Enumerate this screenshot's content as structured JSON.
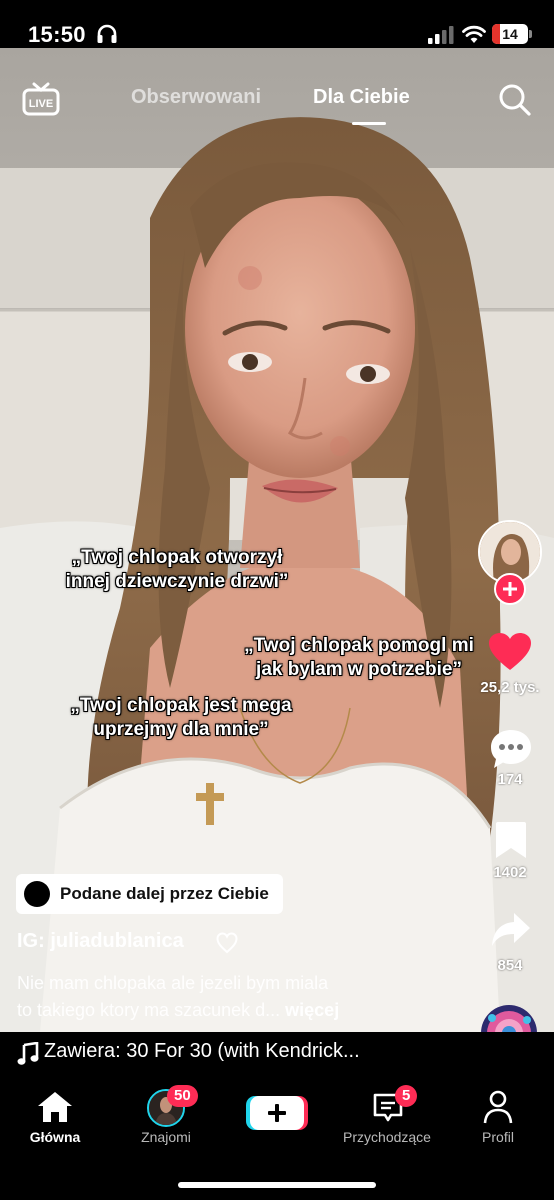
{
  "status_bar": {
    "time": "15:50",
    "battery": "14"
  },
  "top_nav": {
    "live_icon": "live-tv-icon",
    "tabs": [
      {
        "label": "Obserwowani",
        "active": false
      },
      {
        "label": "Dla Ciebie",
        "active": true
      }
    ],
    "search_icon": "search-icon"
  },
  "overlay_captions": [
    {
      "lines": [
        "„Twoj chlopak otworzył",
        "innej dziewczynie drzwi”"
      ]
    },
    {
      "lines": [
        "„Twoj chlopak pomogl mi",
        "jak bylam w potrzebie”"
      ]
    },
    {
      "lines": [
        "„Twoj chlopak jest mega",
        "uprzejmy dla mnie”"
      ]
    }
  ],
  "right_rail": {
    "likes": "25,2 tys.",
    "comments": "174",
    "saves": "1402",
    "shares": "854"
  },
  "post": {
    "reposted_label": "Podane dalej przez Ciebie",
    "username": "IG: juliadublanica",
    "caption_line1": "Nie mam chlopaka ale jezeli bym miala",
    "caption_line2": "to takiego ktory ma szacunek d...",
    "more": "więcej"
  },
  "music": {
    "text": "Zawiera: 30 For 30 (with Kendrick..."
  },
  "bottom_nav": {
    "items": [
      {
        "label": "Główna",
        "icon": "home-icon",
        "active": true
      },
      {
        "label": "Znajomi",
        "icon": "friends-avatar",
        "badge": "50",
        "active": false
      },
      {
        "label": "",
        "icon": "create-plus-icon",
        "active": false
      },
      {
        "label": "Przychodzące",
        "icon": "inbox-icon",
        "badge": "5",
        "active": false
      },
      {
        "label": "Profil",
        "icon": "profile-icon",
        "active": false
      }
    ]
  },
  "colors": {
    "accent": "#fe2c55",
    "battery_low": "#e5342c",
    "background": "#000000"
  }
}
